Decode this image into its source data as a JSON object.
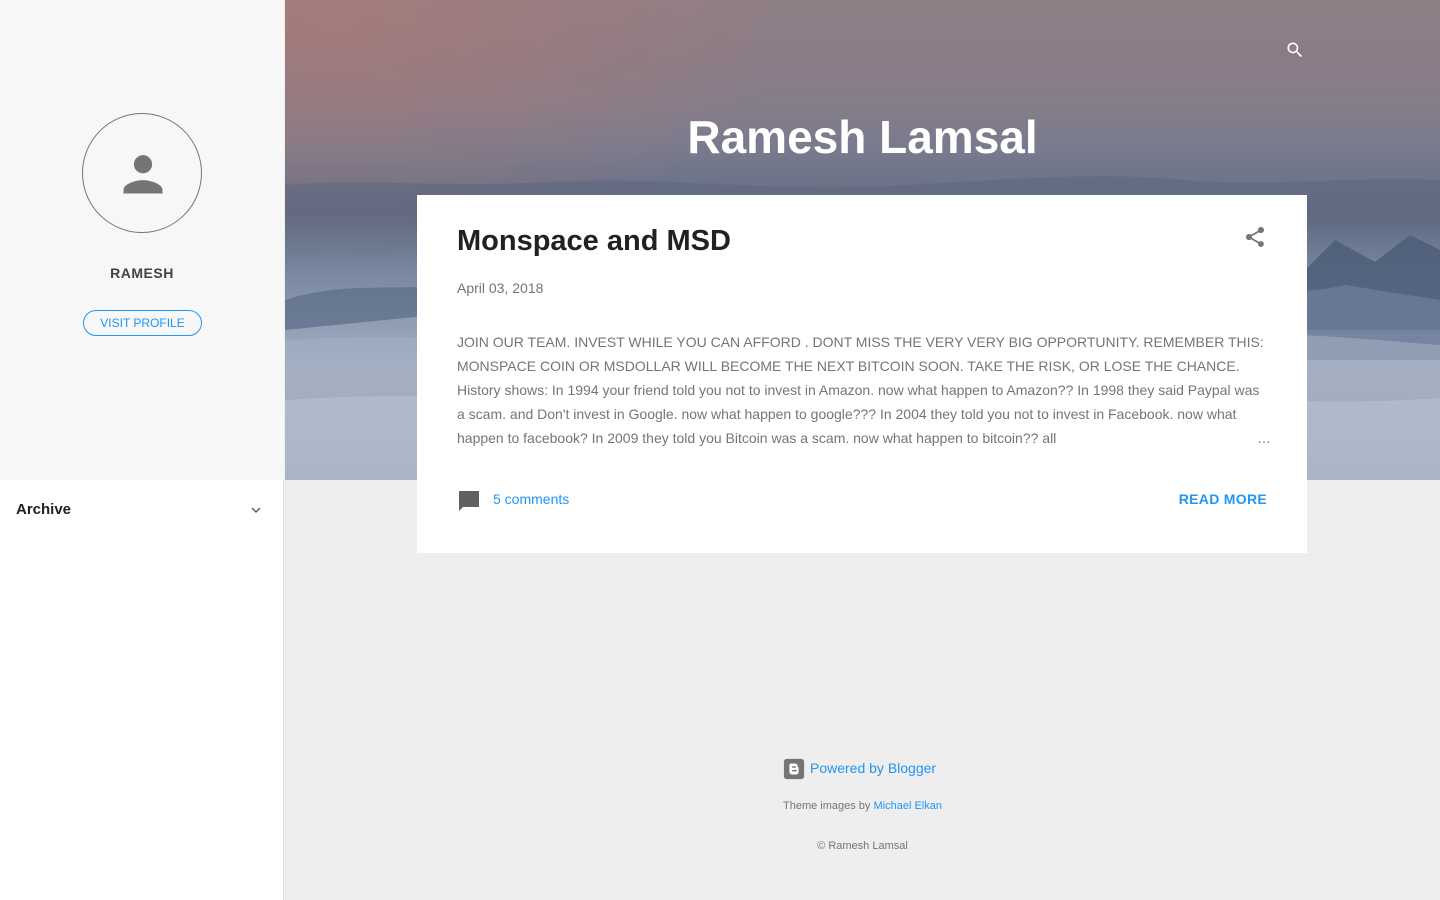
{
  "sidebar": {
    "profile_name": "RAMESH",
    "visit_profile_label": "VISIT PROFILE",
    "archive_label": "Archive"
  },
  "header": {
    "blog_title": "Ramesh Lamsal"
  },
  "post": {
    "title": "Monspace and MSD",
    "date": "April 03, 2018",
    "snippet": "JOIN OUR TEAM. INVEST WHILE YOU CAN AFFORD . DONT MISS THE VERY VERY BIG OPPORTUNITY. REMEMBER THIS: MONSPACE COIN OR MSDOLLAR WILL BECOME THE NEXT BITCOIN SOON. TAKE THE RISK, OR LOSE THE CHANCE. History shows: In 1994 your friend told you not to invest in Amazon. now what happen to Amazon?? In 1998 they said Paypal was a scam. and Don't invest in Google. now what happen to google??? In 2004 they told you not to invest in Facebook. now what happen to facebook? In 2009 they told you Bitcoin was a scam. now what happen to bitcoin?? all",
    "ellipsis": "…",
    "comments_label": "5 comments",
    "read_more_label": "READ MORE"
  },
  "footer": {
    "powered_by": "Powered by Blogger",
    "theme_prefix": "Theme images by",
    "theme_author": "Michael Elkan",
    "copyright": "© Ramesh Lamsal"
  },
  "colors": {
    "accent": "#2196f3",
    "icon_gray": "#757575",
    "page_bg": "#eeeeee",
    "sidebar_bg": "#f7f7f7"
  },
  "icons": [
    "person-icon",
    "chevron-down-icon",
    "search-icon",
    "share-icon",
    "comment-icon",
    "blogger-icon"
  ]
}
